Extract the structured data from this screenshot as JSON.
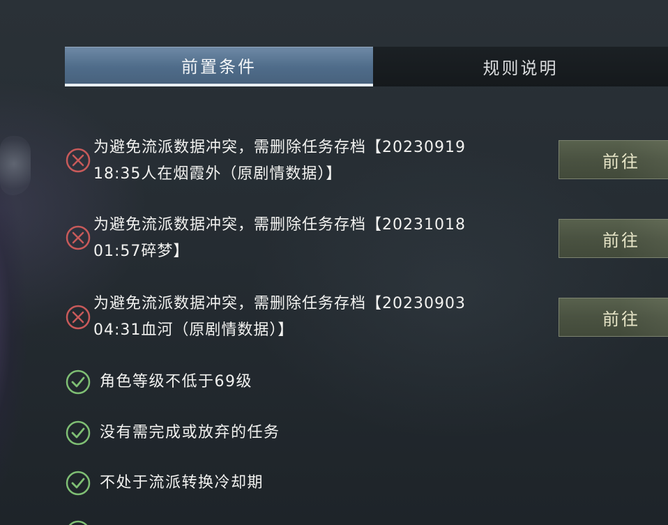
{
  "tabs": [
    {
      "label": "前置条件",
      "active": true
    },
    {
      "label": "规则说明",
      "active": false
    }
  ],
  "blocked_conditions": [
    {
      "line1": "为避免流派数据冲突，需删除任务存档【20230919",
      "line2": "18:35人在烟霞外（原剧情数据）】",
      "button": "前往",
      "status": "unmet"
    },
    {
      "line1": "为避免流派数据冲突，需删除任务存档【20231018",
      "line2": "01:57碎梦】",
      "button": "前往",
      "status": "unmet"
    },
    {
      "line1": "为避免流派数据冲突，需删除任务存档【20230903",
      "line2": "04:31血河（原剧情数据）】",
      "button": "前往",
      "status": "unmet"
    }
  ],
  "met_conditions": [
    {
      "text": "角色等级不低于69级",
      "status": "met"
    },
    {
      "text": "没有需完成或放弃的任务",
      "status": "met"
    },
    {
      "text": "不处于流派转换冷却期",
      "status": "met"
    }
  ],
  "colors": {
    "unmet": "#c85a5a",
    "met": "#7fbf74",
    "tab_active": "#5a7896",
    "button": "#4f5845"
  },
  "icons": {
    "unmet": "close-circle-icon",
    "met": "check-circle-icon"
  }
}
